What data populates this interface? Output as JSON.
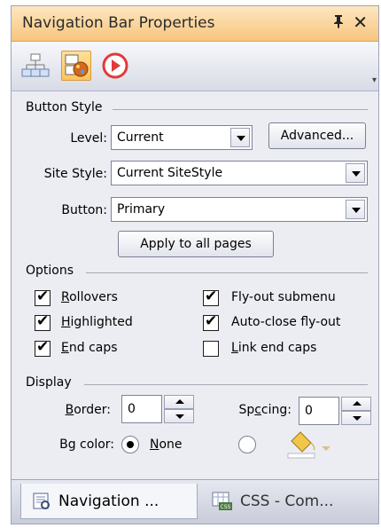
{
  "panel": {
    "title": "Navigation Bar Properties",
    "pin_glyph": "⌶",
    "close_glyph": "✕"
  },
  "toolbar": {
    "buttons": [
      {
        "icon": "navigation-structure-icon"
      },
      {
        "icon": "button-style-icon"
      },
      {
        "icon": "record-stop-icon"
      }
    ],
    "overflow_glyph": "▾"
  },
  "button_style": {
    "heading": "Button Style",
    "level_label": "Level:",
    "level_value": "Current",
    "advanced_label": "Advanced...",
    "site_style_label": "Site Style:",
    "site_style_value": "Current SiteStyle",
    "button_label": "Button:",
    "button_value": "Primary",
    "apply_label": "Apply to all pages"
  },
  "options": {
    "heading": "Options",
    "rollovers": {
      "label": "Rollovers",
      "checked": true
    },
    "flyout_submenu": {
      "label": "Fly-out submenu",
      "checked": true
    },
    "highlighted": {
      "label": "Highlighted",
      "checked": true
    },
    "autoclose_flyout": {
      "label": "Auto-close fly-out",
      "checked": true
    },
    "end_caps": {
      "label": "End caps",
      "checked": true
    },
    "link_end_caps": {
      "label": "Link end caps",
      "checked": false
    }
  },
  "display": {
    "heading": "Display",
    "border_label": "Border:",
    "border_value": "0",
    "spacing_label": "Spacing:",
    "spacing_value": "0",
    "bgcolor_label": "Bg color:",
    "bgcolor_none_label": "None"
  },
  "tabs": [
    {
      "label": "Navigation ..."
    },
    {
      "label": "CSS - Com..."
    }
  ],
  "colors": {
    "title_gradient_top": "#fde7c0",
    "title_gradient_bottom": "#f7c57e",
    "panel_bg": "#ececf3"
  }
}
